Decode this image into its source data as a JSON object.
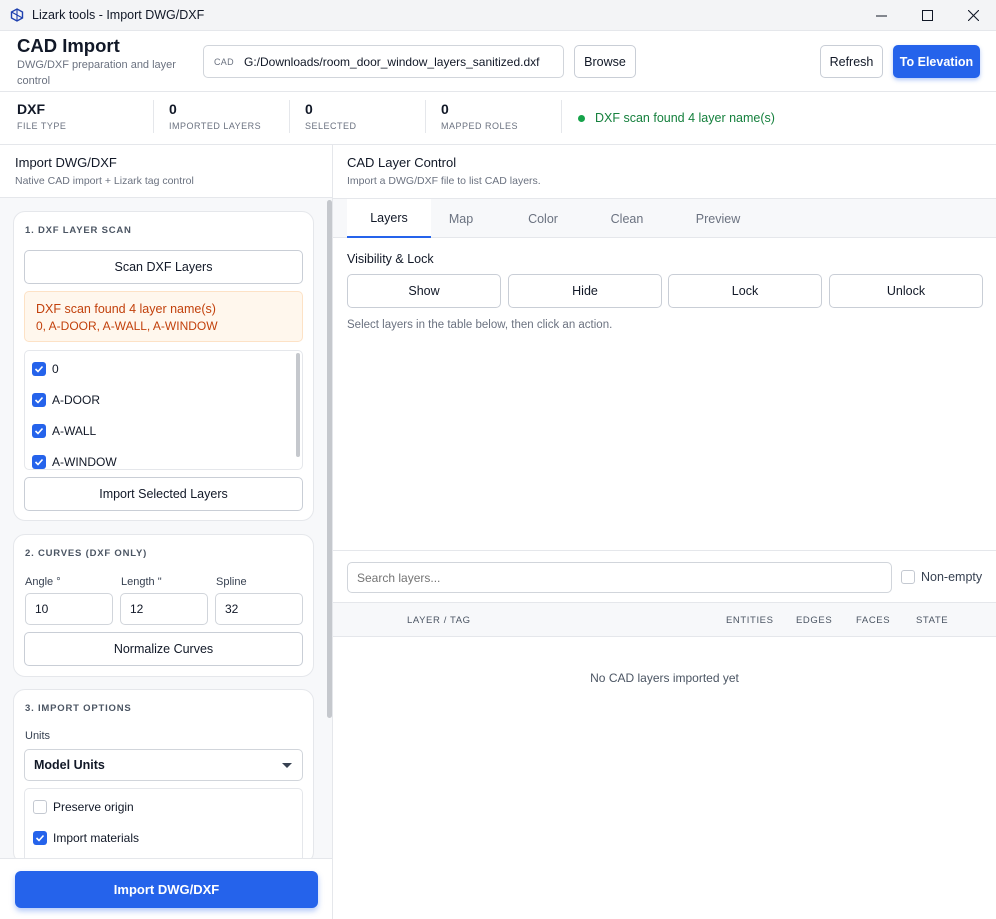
{
  "window": {
    "title": "Lizark tools - Import DWG/DXF"
  },
  "header": {
    "title": "CAD Import",
    "subtitle": "DWG/DXF preparation and layer control",
    "path_tag": "CAD",
    "path_value": "G:/Downloads/room_door_window_layers_sanitized.dxf",
    "browse_label": "Browse",
    "refresh_label": "Refresh",
    "elevation_label": "To Elevation"
  },
  "stats": [
    {
      "value": "DXF",
      "label": "FILE TYPE"
    },
    {
      "value": "0",
      "label": "IMPORTED LAYERS"
    },
    {
      "value": "0",
      "label": "SELECTED"
    },
    {
      "value": "0",
      "label": "MAPPED ROLES"
    }
  ],
  "status": {
    "text": "DXF scan found 4 layer name(s)",
    "color": "#15803d"
  },
  "left": {
    "title": "Import DWG/DXF",
    "subtitle": "Native CAD import + Lizark tag control",
    "scan": {
      "title": "1. DXF LAYER SCAN",
      "scan_button": "Scan DXF Layers",
      "alert_line1": "DXF scan found 4 layer name(s)",
      "alert_line2": "0, A-DOOR, A-WALL, A-WINDOW",
      "layers": [
        {
          "name": "0",
          "checked": true
        },
        {
          "name": "A-DOOR",
          "checked": true
        },
        {
          "name": "A-WALL",
          "checked": true
        },
        {
          "name": "A-WINDOW",
          "checked": true
        }
      ],
      "import_selected_button": "Import Selected Layers"
    },
    "curves": {
      "title": "2. CURVES (DXF ONLY)",
      "angle_label": "Angle °",
      "angle_value": "10",
      "length_label": "Length \"",
      "length_value": "12",
      "spline_label": "Spline",
      "spline_value": "32",
      "normalize_button": "Normalize Curves"
    },
    "options": {
      "title": "3. IMPORT OPTIONS",
      "units_label": "Units",
      "units_value": "Model Units",
      "preserve_origin": {
        "label": "Preserve origin",
        "checked": false
      },
      "import_materials": {
        "label": "Import materials",
        "checked": true
      }
    },
    "import_button": "Import DWG/DXF"
  },
  "right": {
    "title": "CAD Layer Control",
    "subtitle": "Import a DWG/DXF file to list CAD layers.",
    "tabs": [
      "Layers",
      "Map",
      "Color",
      "Clean",
      "Preview"
    ],
    "active_tab": "Layers",
    "section_title": "Visibility & Lock",
    "actions": [
      "Show",
      "Hide",
      "Lock",
      "Unlock"
    ],
    "hint": "Select layers in the table below, then click an action.",
    "search_placeholder": "Search layers...",
    "nonempty_label": "Non-empty",
    "columns": [
      "LAYER / TAG",
      "ENTITIES",
      "EDGES",
      "FACES",
      "STATE"
    ],
    "empty_message": "No CAD layers imported yet"
  },
  "colors": {
    "accent": "#2563eb",
    "warning_bg": "#fff7ed",
    "warning_text": "#c2410c"
  }
}
